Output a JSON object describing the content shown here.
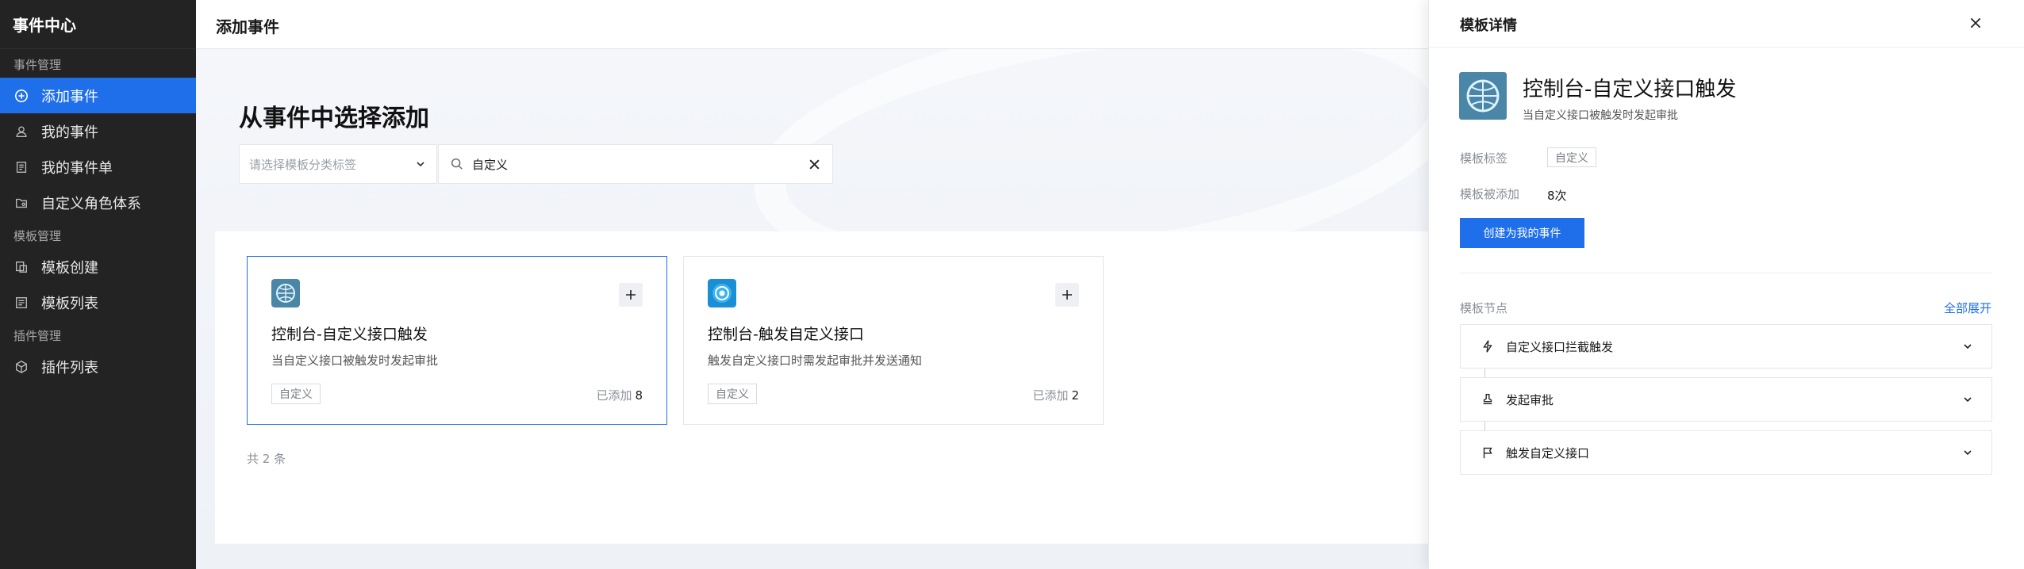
{
  "sidebar": {
    "brand": "事件中心",
    "groups": [
      {
        "title": "事件管理"
      },
      {
        "title": "模板管理"
      },
      {
        "title": "插件管理"
      }
    ],
    "items": [
      {
        "label": "添加事件",
        "icon": "add-circle-icon",
        "active": true
      },
      {
        "label": "我的事件",
        "icon": "user-icon"
      },
      {
        "label": "我的事件单",
        "icon": "document-list-icon"
      },
      {
        "label": "自定义角色体系",
        "icon": "folder-user-icon"
      },
      {
        "label": "模板创建",
        "icon": "template-create-icon"
      },
      {
        "label": "模板列表",
        "icon": "template-list-icon"
      },
      {
        "label": "插件列表",
        "icon": "cube-icon"
      }
    ]
  },
  "header": {
    "title": "添加事件"
  },
  "main": {
    "heading": "从事件中选择添加",
    "category_select": {
      "placeholder": "请选择模板分类标签"
    },
    "search": {
      "value": "自定义"
    },
    "cards": [
      {
        "name": "控制台-自定义接口触发",
        "desc": "当自定义接口被触发时发起审批",
        "tag": "自定义",
        "added_label": "已添加",
        "added_count": "8",
        "logo": "globe-logo-icon"
      },
      {
        "name": "控制台-触发自定义接口",
        "desc": "触发自定义接口时需发起审批并发送通知",
        "tag": "自定义",
        "added_label": "已添加",
        "added_count": "2",
        "logo": "target-logo-icon"
      }
    ],
    "total": "共 2 条"
  },
  "drawer": {
    "title": "模板详情",
    "name": "控制台-自定义接口触发",
    "desc": "当自定义接口被触发时发起审批",
    "tag_label": "模板标签",
    "tag": "自定义",
    "added_label": "模板被添加",
    "added_count": "8次",
    "cta": "创建为我的事件",
    "nodes_title": "模板节点",
    "expand_all": "全部展开",
    "nodes": [
      {
        "label": "自定义接口拦截触发",
        "icon": "lightning-icon"
      },
      {
        "label": "发起审批",
        "icon": "stamp-icon"
      },
      {
        "label": "触发自定义接口",
        "icon": "flag-icon"
      }
    ]
  },
  "colors": {
    "accent": "#1f6feb",
    "sidebar_bg": "#232323"
  }
}
